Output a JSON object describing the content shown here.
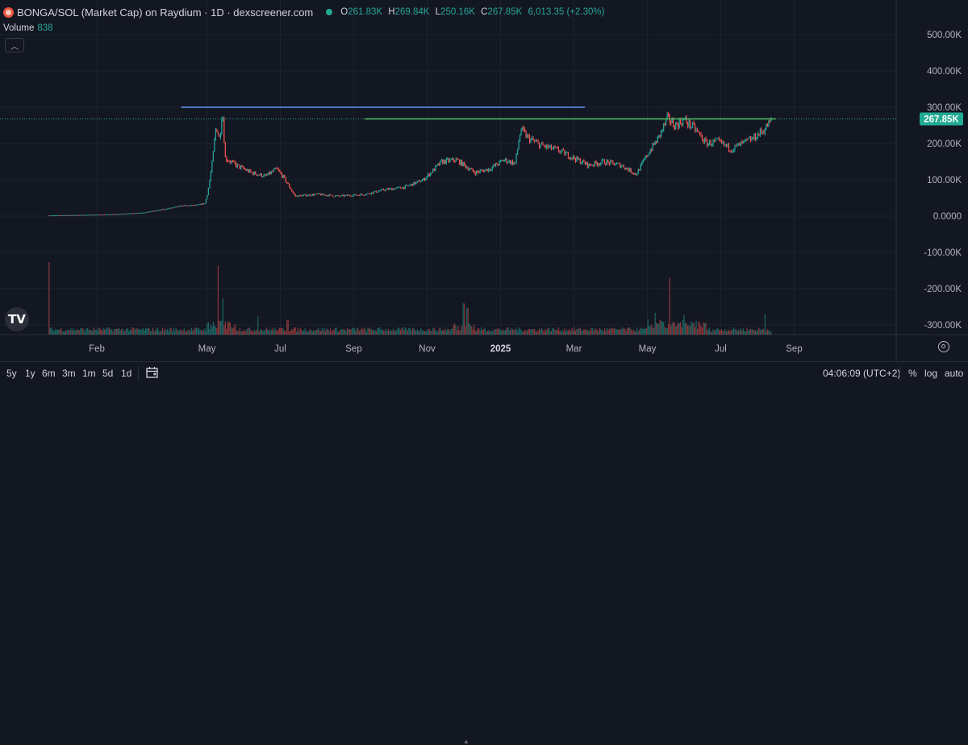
{
  "header": {
    "symbol": "BONGA/SOL (Market Cap) on Raydium · 1D · dexscreener.com",
    "ohlc": {
      "o_label": "O",
      "o": "261.83K",
      "h_label": "H",
      "h": "269.84K",
      "l_label": "L",
      "l": "250.16K",
      "c_label": "C",
      "c": "267.85K",
      "change": "6,013.35 (+2.30%)"
    },
    "volume_label": "Volume",
    "volume_value": "838"
  },
  "toolbar": {
    "ranges": [
      "5y",
      "1y",
      "6m",
      "3m",
      "1m",
      "5d",
      "1d"
    ],
    "time": "04:06:09 (UTC+2)",
    "percent": "%",
    "log": "log",
    "auto": "auto"
  },
  "colors": {
    "up": "#26a69a",
    "down": "#ef5350",
    "line_blue": "#5b9cf6",
    "line_green": "#5ec95a",
    "price_label": "#22ab94",
    "background": "#131722"
  },
  "chart_data": {
    "type": "candlestick",
    "y_ticks": [
      500,
      400,
      300,
      200,
      100,
      0,
      -100,
      -200,
      -300
    ],
    "y_tick_labels": [
      "500.00K",
      "400.00K",
      "300.00K",
      "200.00K",
      "100.00K",
      "0.0000",
      "-100.00K",
      "-200.00K",
      "-300.00K"
    ],
    "ylim": [
      -330,
      560
    ],
    "y_unit": "K",
    "x_labels": [
      {
        "label": "Feb",
        "month": 1.0
      },
      {
        "label": "May",
        "month": 4.0
      },
      {
        "label": "Jul",
        "month": 6.0
      },
      {
        "label": "Sep",
        "month": 8.0
      },
      {
        "label": "Nov",
        "month": 10.0
      },
      {
        "label": "2025",
        "month": 12.0
      },
      {
        "label": "Mar",
        "month": 14.0
      },
      {
        "label": "May",
        "month": 16.0
      },
      {
        "label": "Jul",
        "month": 18.0
      },
      {
        "label": "Sep",
        "month": 20.0
      }
    ],
    "last_price": 267.85,
    "last_price_label": "267.85K",
    "horizontal_lines": [
      {
        "color": "blue",
        "value": 300,
        "from_month": 3.3,
        "to_month": 14.3
      },
      {
        "color": "green",
        "value": 267.85,
        "from_month": 8.3,
        "to_month": 19.5
      }
    ],
    "close_path": [
      [
        -0.3,
        2
      ],
      [
        0.5,
        3
      ],
      [
        1.5,
        5
      ],
      [
        2.3,
        10
      ],
      [
        2.9,
        20
      ],
      [
        3.3,
        28
      ],
      [
        3.7,
        30
      ],
      [
        3.95,
        35
      ],
      [
        4.05,
        80
      ],
      [
        4.15,
        150
      ],
      [
        4.25,
        250
      ],
      [
        4.35,
        210
      ],
      [
        4.42,
        300
      ],
      [
        4.5,
        160
      ],
      [
        4.8,
        140
      ],
      [
        5.2,
        120
      ],
      [
        5.6,
        110
      ],
      [
        5.9,
        130
      ],
      [
        6.1,
        105
      ],
      [
        6.4,
        55
      ],
      [
        7.0,
        60
      ],
      [
        7.6,
        55
      ],
      [
        8.3,
        60
      ],
      [
        8.8,
        72
      ],
      [
        9.4,
        80
      ],
      [
        9.9,
        100
      ],
      [
        10.4,
        150
      ],
      [
        10.8,
        155
      ],
      [
        11.3,
        120
      ],
      [
        11.7,
        130
      ],
      [
        12.1,
        155
      ],
      [
        12.4,
        145
      ],
      [
        12.55,
        240
      ],
      [
        12.75,
        215
      ],
      [
        13.1,
        195
      ],
      [
        13.6,
        180
      ],
      [
        14.0,
        160
      ],
      [
        14.4,
        140
      ],
      [
        14.8,
        150
      ],
      [
        15.3,
        140
      ],
      [
        15.7,
        115
      ],
      [
        16.0,
        170
      ],
      [
        16.3,
        215
      ],
      [
        16.55,
        270
      ],
      [
        16.75,
        250
      ],
      [
        17.0,
        265
      ],
      [
        17.3,
        240
      ],
      [
        17.6,
        200
      ],
      [
        17.9,
        205
      ],
      [
        18.3,
        185
      ],
      [
        18.6,
        200
      ],
      [
        18.9,
        215
      ],
      [
        19.2,
        240
      ],
      [
        19.4,
        267.85
      ]
    ],
    "volume_spikes": [
      {
        "month": -0.3,
        "value": 1.0
      },
      {
        "month": 4.3,
        "value": 0.95
      },
      {
        "month": 16.6,
        "value": 0.78
      },
      {
        "month": 4.45,
        "value": 0.5
      },
      {
        "month": 11.0,
        "value": 0.43
      },
      {
        "month": 11.1,
        "value": 0.37
      },
      {
        "month": 19.4,
        "value": 0.38
      },
      {
        "month": 19.2,
        "value": 0.28
      },
      {
        "month": 5.4,
        "value": 0.25
      },
      {
        "month": 16.2,
        "value": 0.3
      },
      {
        "month": 17.0,
        "value": 0.27
      },
      {
        "month": 6.2,
        "value": 0.2
      }
    ]
  }
}
